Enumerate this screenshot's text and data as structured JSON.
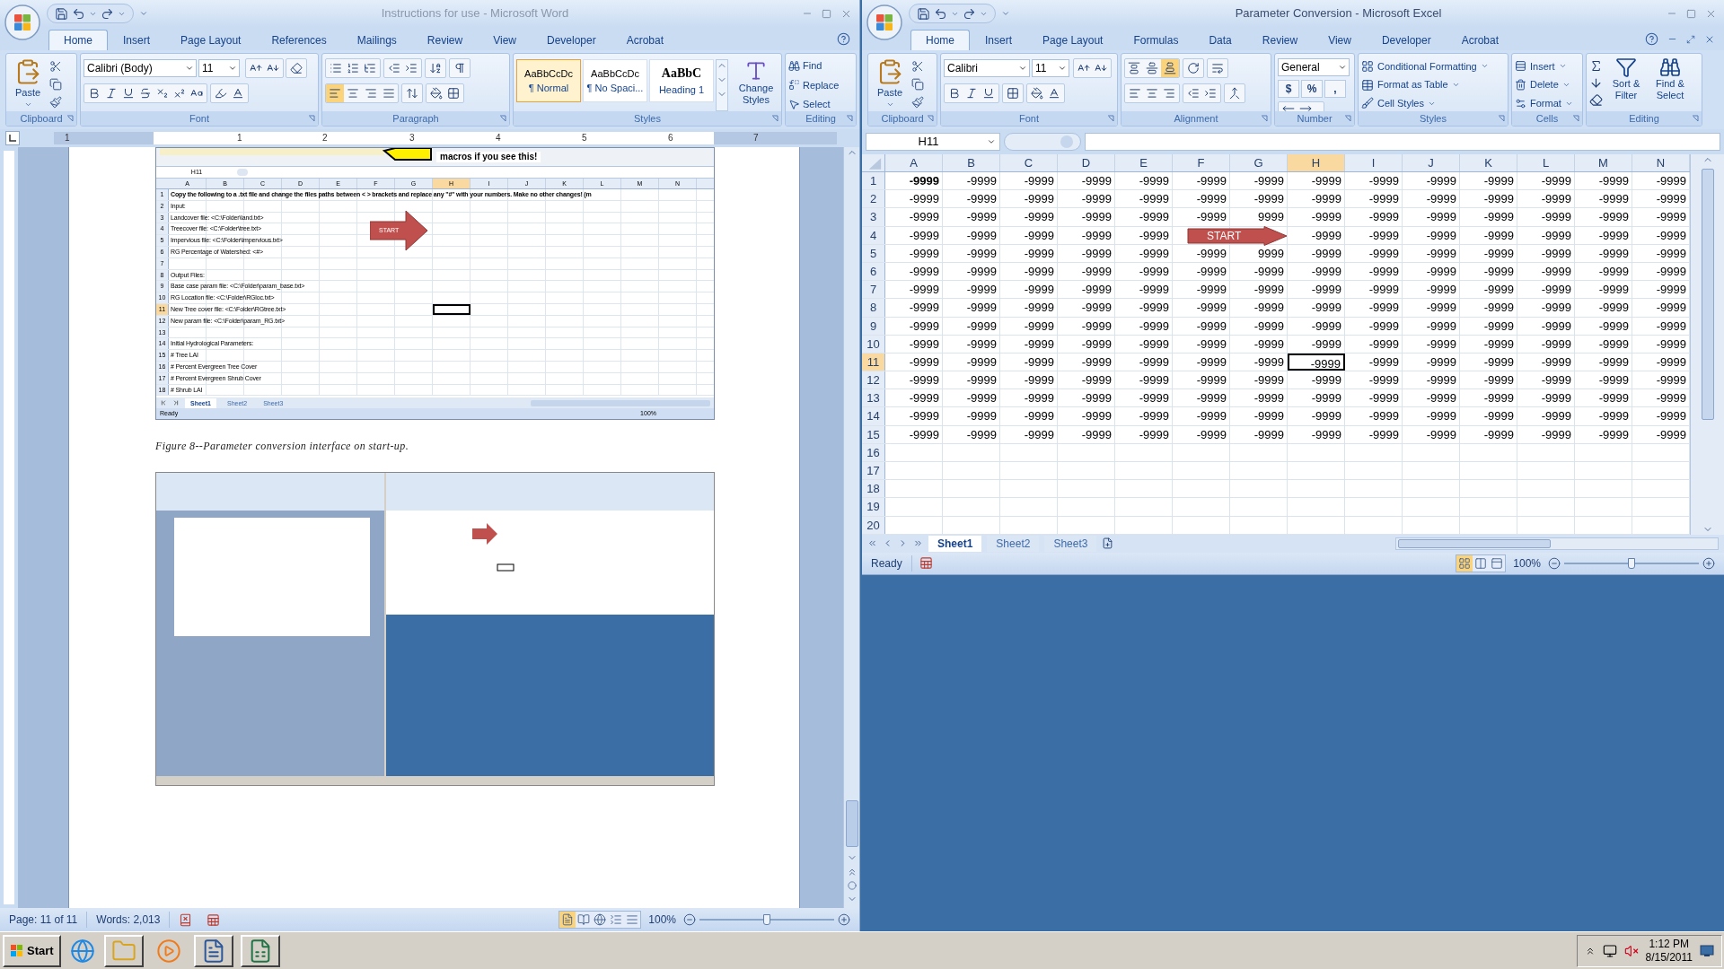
{
  "word": {
    "title": "Instructions for use - Microsoft Word",
    "active": false,
    "tabs": [
      {
        "label": "Home",
        "selected": true
      },
      {
        "label": "Insert",
        "selected": false
      },
      {
        "label": "Page Layout",
        "selected": false
      },
      {
        "label": "References",
        "selected": false
      },
      {
        "label": "Mailings",
        "selected": false
      },
      {
        "label": "Review",
        "selected": false
      },
      {
        "label": "View",
        "selected": false
      },
      {
        "label": "Developer",
        "selected": false
      },
      {
        "label": "Acrobat",
        "selected": false
      }
    ],
    "ribbon": {
      "clipboard": {
        "group": "Clipboard",
        "paste": "Paste"
      },
      "font": {
        "group": "Font",
        "family": "Calibri (Body)",
        "size": "11"
      },
      "paragraph": {
        "group": "Paragraph",
        "align_buttons": [
          {
            "selected": true
          },
          {
            "selected": false
          },
          {
            "selected": false
          },
          {
            "selected": false
          }
        ]
      },
      "styles": {
        "group": "Styles",
        "items": [
          {
            "preview": "AaBbCcDc",
            "name": "¶ Normal",
            "selected": true
          },
          {
            "preview": "AaBbCcDc",
            "name": "¶ No Spaci...",
            "selected": false
          },
          {
            "preview": "AaBbC",
            "name": "Heading 1",
            "selected": false
          }
        ],
        "change": "Change Styles"
      },
      "editing": {
        "group": "Editing",
        "find": "Find",
        "replace": "Replace",
        "select": "Select"
      }
    },
    "ruler_numbers": [
      "1",
      "1",
      "2",
      "3",
      "4",
      "5",
      "6",
      "7"
    ],
    "document": {
      "screenshot": {
        "callout": "macros if you see this!",
        "name_box": "H11",
        "columns": [
          {
            "label": "A",
            "selected": false
          },
          {
            "label": "B",
            "selected": false
          },
          {
            "label": "C",
            "selected": false
          },
          {
            "label": "D",
            "selected": false
          },
          {
            "label": "E",
            "selected": false
          },
          {
            "label": "F",
            "selected": false
          },
          {
            "label": "G",
            "selected": false
          },
          {
            "label": "H",
            "selected": true
          },
          {
            "label": "I",
            "selected": false
          },
          {
            "label": "J",
            "selected": false
          },
          {
            "label": "K",
            "selected": false
          },
          {
            "label": "L",
            "selected": false
          },
          {
            "label": "M",
            "selected": false
          },
          {
            "label": "N",
            "selected": false
          }
        ],
        "rows": [
          {
            "header": "1",
            "selected": false,
            "bold": true,
            "text": "Copy the following to a .txt file and change the files paths between < > brackets and replace any \"#\" with your numbers.  Make no other changes! (m"
          },
          {
            "header": "2",
            "selected": false,
            "bold": false,
            "text": "Input:"
          },
          {
            "header": "3",
            "selected": false,
            "bold": false,
            "text": "Landcover file: <C:\\Folder\\land.txt>"
          },
          {
            "header": "4",
            "selected": false,
            "bold": false,
            "text": "Treecover file: <C:\\Folder\\tree.txt>"
          },
          {
            "header": "5",
            "selected": false,
            "bold": false,
            "text": "Impervious file: <C:\\Folder\\impervious.txt>"
          },
          {
            "header": "6",
            "selected": false,
            "bold": false,
            "text": "RG Percentage of Watershed: <#>"
          },
          {
            "header": "7",
            "selected": false
          },
          {
            "header": "8",
            "selected": false,
            "bold": false,
            "text": "Output Files:"
          },
          {
            "header": "9",
            "selected": false,
            "bold": false,
            "text": "Base case param file: <C:\\Folder\\param_base.txt>"
          },
          {
            "header": "10",
            "selected": false,
            "bold": false,
            "text": "RG Location file: <C:\\Folder\\RGloc.txt>"
          },
          {
            "header": "11",
            "selected": true,
            "bold": false,
            "text": "New Tree cover file: <C:\\Folder\\RGtree.txt>"
          },
          {
            "header": "12",
            "selected": false,
            "bold": false,
            "text": "New param file: <C:\\Folder\\param_RG.txt>"
          },
          {
            "header": "13",
            "selected": false
          },
          {
            "header": "14",
            "selected": false,
            "bold": false,
            "text": "Initial Hydrological Parameters:"
          },
          {
            "header": "15",
            "selected": false,
            "bold": false,
            "text": "# Tree LAI"
          },
          {
            "header": "16",
            "selected": false,
            "bold": false,
            "text": "# Percent Evergreen Tree Cover"
          },
          {
            "header": "17",
            "selected": false,
            "bold": false,
            "text": "# Percent Evergreen Shrub Cover"
          },
          {
            "header": "18",
            "selected": false,
            "bold": false,
            "text": "# Shrub LAI"
          }
        ],
        "arrow": "START",
        "sheets": [
          {
            "label": "Sheet1",
            "selected": true
          },
          {
            "label": "Sheet2",
            "selected": false
          },
          {
            "label": "Sheet3",
            "selected": false
          }
        ],
        "status": "Ready",
        "zoom": "100%"
      },
      "caption": "Figure 8--Parameter conversion interface on start-up."
    },
    "status": {
      "page": "Page: 11 of 11",
      "words": "Words: 2,013",
      "view_buttons": [
        {
          "selected": true
        },
        {
          "selected": false
        },
        {
          "selected": false
        },
        {
          "selected": false
        },
        {
          "selected": false
        }
      ],
      "zoom": "100%",
      "zoom_slider": {
        "level": 0.5
      }
    }
  },
  "excel": {
    "title": "Parameter Conversion - Microsoft Excel",
    "active": true,
    "tabs": [
      {
        "label": "Home",
        "selected": true
      },
      {
        "label": "Insert",
        "selected": false
      },
      {
        "label": "Page Layout",
        "selected": false
      },
      {
        "label": "Formulas",
        "selected": false
      },
      {
        "label": "Data",
        "selected": false
      },
      {
        "label": "Review",
        "selected": false
      },
      {
        "label": "View",
        "selected": false
      },
      {
        "label": "Developer",
        "selected": false
      },
      {
        "label": "Acrobat",
        "selected": false
      }
    ],
    "ribbon": {
      "clipboard": {
        "group": "Clipboard",
        "paste": "Paste"
      },
      "font": {
        "group": "Font",
        "family": "Calibri",
        "size": "11"
      },
      "alignment": {
        "group": "Alignment",
        "vertical_buttons": [
          {
            "selected": false
          },
          {
            "selected": false
          },
          {
            "selected": true
          }
        ]
      },
      "number": {
        "group": "Number",
        "format": "General",
        "buttons": [
          "$",
          "%",
          ","
        ]
      },
      "styles": {
        "group": "Styles",
        "items": [
          "Conditional Formatting",
          "Format as Table",
          "Cell Styles"
        ]
      },
      "cells": {
        "group": "Cells",
        "items": [
          "Insert",
          "Delete",
          "Format"
        ]
      },
      "editing": {
        "group": "Editing",
        "sort": "Sort & Filter",
        "find": "Find & Select"
      }
    },
    "name_box": "H11",
    "columns": [
      {
        "label": "A",
        "selected": false
      },
      {
        "label": "B",
        "selected": false
      },
      {
        "label": "C",
        "selected": false
      },
      {
        "label": "D",
        "selected": false
      },
      {
        "label": "E",
        "selected": false
      },
      {
        "label": "F",
        "selected": false
      },
      {
        "label": "G",
        "selected": false
      },
      {
        "label": "H",
        "selected": true
      },
      {
        "label": "I",
        "selected": false
      },
      {
        "label": "J",
        "selected": false
      },
      {
        "label": "K",
        "selected": false
      },
      {
        "label": "L",
        "selected": false
      },
      {
        "label": "M",
        "selected": false
      },
      {
        "label": "N",
        "selected": false
      }
    ],
    "rows": [
      {
        "header": "1",
        "selected": false,
        "first_bold": true,
        "cells": [
          "-9999",
          "-9999",
          "-9999",
          "-9999",
          "-9999",
          "-9999",
          "-9999",
          "-9999",
          "-9999",
          "-9999",
          "-9999",
          "-9999",
          "-9999",
          "-9999"
        ]
      },
      {
        "header": "2",
        "selected": false,
        "first_bold": false,
        "cells": [
          "-9999",
          "-9999",
          "-9999",
          "-9999",
          "-9999",
          "-9999",
          "-9999",
          "-9999",
          "-9999",
          "-9999",
          "-9999",
          "-9999",
          "-9999",
          "-9999"
        ]
      },
      {
        "header": "3",
        "selected": false,
        "first_bold": false,
        "cells": [
          "-9999",
          "-9999",
          "-9999",
          "-9999",
          "-9999",
          "-9999",
          "9999",
          "-9999",
          "-9999",
          "-9999",
          "-9999",
          "-9999",
          "-9999",
          "-9999"
        ]
      },
      {
        "header": "4",
        "selected": false,
        "first_bold": false,
        "cells": [
          "-9999",
          "-9999",
          "-9999",
          "-9999",
          "-9999",
          null,
          null,
          "-9999",
          "-9999",
          "-9999",
          "-9999",
          "-9999",
          "-9999",
          "-9999"
        ]
      },
      {
        "header": "5",
        "selected": false,
        "first_bold": false,
        "cells": [
          "-9999",
          "-9999",
          "-9999",
          "-9999",
          "-9999",
          "-9999",
          "9999",
          "-9999",
          "-9999",
          "-9999",
          "-9999",
          "-9999",
          "-9999",
          "-9999"
        ]
      },
      {
        "header": "6",
        "selected": false,
        "first_bold": false,
        "cells": [
          "-9999",
          "-9999",
          "-9999",
          "-9999",
          "-9999",
          "-9999",
          "-9999",
          "-9999",
          "-9999",
          "-9999",
          "-9999",
          "-9999",
          "-9999",
          "-9999"
        ]
      },
      {
        "header": "7",
        "selected": false,
        "first_bold": false,
        "cells": [
          "-9999",
          "-9999",
          "-9999",
          "-9999",
          "-9999",
          "-9999",
          "-9999",
          "-9999",
          "-9999",
          "-9999",
          "-9999",
          "-9999",
          "-9999",
          "-9999"
        ]
      },
      {
        "header": "8",
        "selected": false,
        "first_bold": false,
        "cells": [
          "-9999",
          "-9999",
          "-9999",
          "-9999",
          "-9999",
          "-9999",
          "-9999",
          "-9999",
          "-9999",
          "-9999",
          "-9999",
          "-9999",
          "-9999",
          "-9999"
        ]
      },
      {
        "header": "9",
        "selected": false,
        "first_bold": false,
        "cells": [
          "-9999",
          "-9999",
          "-9999",
          "-9999",
          "-9999",
          "-9999",
          "-9999",
          "-9999",
          "-9999",
          "-9999",
          "-9999",
          "-9999",
          "-9999",
          "-9999"
        ]
      },
      {
        "header": "10",
        "selected": false,
        "first_bold": false,
        "cells": [
          "-9999",
          "-9999",
          "-9999",
          "-9999",
          "-9999",
          "-9999",
          "-9999",
          "-9999",
          "-9999",
          "-9999",
          "-9999",
          "-9999",
          "-9999",
          "-9999"
        ]
      },
      {
        "header": "11",
        "selected": true,
        "first_bold": false,
        "cells": [
          "-9999",
          "-9999",
          "-9999",
          "-9999",
          "-9999",
          "-9999",
          "-9999",
          "-9999",
          "-9999",
          "-9999",
          "-9999",
          "-9999",
          "-9999",
          "-9999"
        ]
      },
      {
        "header": "12",
        "selected": false,
        "first_bold": false,
        "cells": [
          "-9999",
          "-9999",
          "-9999",
          "-9999",
          "-9999",
          "-9999",
          "-9999",
          "-9999",
          "-9999",
          "-9999",
          "-9999",
          "-9999",
          "-9999",
          "-9999"
        ]
      },
      {
        "header": "13",
        "selected": false,
        "first_bold": false,
        "cells": [
          "-9999",
          "-9999",
          "-9999",
          "-9999",
          "-9999",
          "-9999",
          "-9999",
          "-9999",
          "-9999",
          "-9999",
          "-9999",
          "-9999",
          "-9999",
          "-9999"
        ]
      },
      {
        "header": "14",
        "selected": false,
        "first_bold": false,
        "cells": [
          "-9999",
          "-9999",
          "-9999",
          "-9999",
          "-9999",
          "-9999",
          "-9999",
          "-9999",
          "-9999",
          "-9999",
          "-9999",
          "-9999",
          "-9999",
          "-9999"
        ]
      },
      {
        "header": "15",
        "selected": false,
        "first_bold": false,
        "cells": [
          "-9999",
          "-9999",
          "-9999",
          "-9999",
          "-9999",
          "-9999",
          "-9999",
          "-9999",
          "-9999",
          "-9999",
          "-9999",
          "-9999",
          "-9999",
          "-9999"
        ]
      },
      {
        "header": "16",
        "selected": false
      },
      {
        "header": "17",
        "selected": false
      },
      {
        "header": "18",
        "selected": false
      },
      {
        "header": "19",
        "selected": false
      },
      {
        "header": "20",
        "selected": false
      }
    ],
    "arrow": "START",
    "sheets": [
      {
        "label": "Sheet1",
        "selected": true
      },
      {
        "label": "Sheet2",
        "selected": false
      },
      {
        "label": "Sheet3",
        "selected": false
      }
    ],
    "status": {
      "ready": "Ready",
      "view_buttons": [
        {
          "selected": true
        },
        {
          "selected": false
        },
        {
          "selected": false
        }
      ],
      "zoom": "100%",
      "zoom_slider": {
        "level": 0.5
      }
    }
  },
  "taskbar": {
    "start": "Start",
    "apps": [
      {
        "open": false
      },
      {
        "open": true
      },
      {
        "open": false
      },
      {
        "open": true
      },
      {
        "open": true
      }
    ],
    "time": "1:12 PM",
    "date": "8/15/2011"
  }
}
